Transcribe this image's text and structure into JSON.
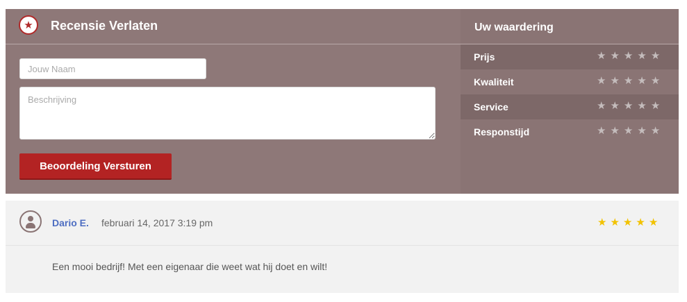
{
  "review_form": {
    "title": "Recensie Verlaten",
    "badge_icon": "star-icon",
    "name_placeholder": "Jouw Naam",
    "description_placeholder": "Beschrijving",
    "submit_label": "Beoordeling Versturen",
    "submit_color": "#b32323"
  },
  "ratings": {
    "title": "Uw waardering",
    "max_stars": 5,
    "empty_star_color": "#c4bcbc",
    "items": [
      {
        "label": "Prijs",
        "value": 0
      },
      {
        "label": "Kwaliteit",
        "value": 0
      },
      {
        "label": "Service",
        "value": 0
      },
      {
        "label": "Responstijd",
        "value": 0
      }
    ]
  },
  "comments": [
    {
      "author": "Dario E.",
      "date": "februari 14, 2017 3:19 pm",
      "rating": 5,
      "text": "Een mooi bedrijf! Met een eigenaar die weet wat hij doet en wilt!",
      "star_color": "#f2c200",
      "avatar_icon": "user-icon"
    }
  ]
}
